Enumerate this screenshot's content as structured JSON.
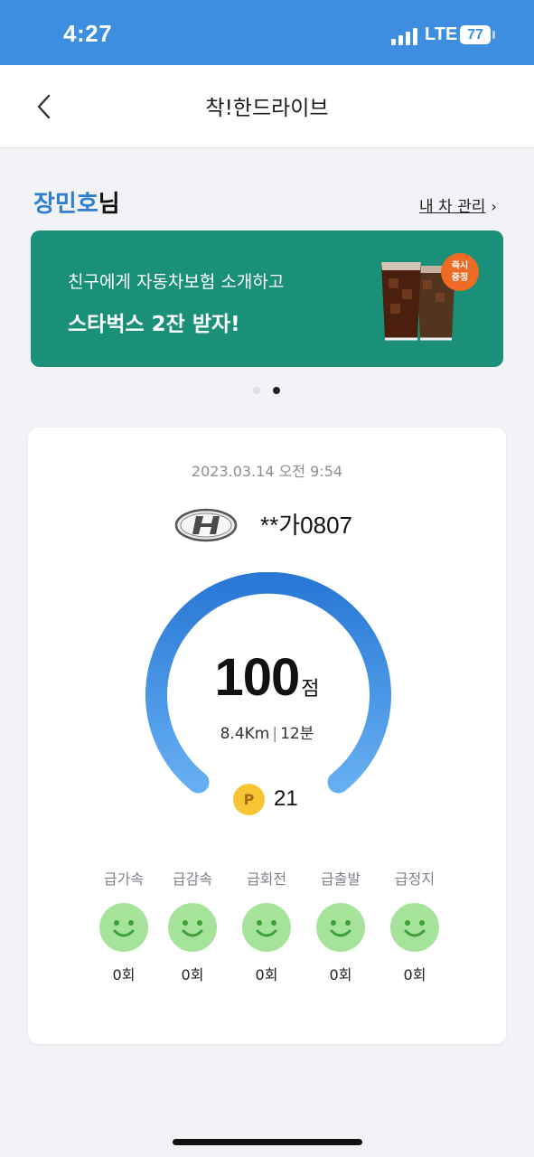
{
  "status_bar": {
    "time": "4:27",
    "network": "LTE",
    "battery": "77"
  },
  "nav": {
    "title": "착!한드라이브",
    "back_icon": "chevron-left-icon"
  },
  "greeting": {
    "name": "장민호",
    "suffix": "님"
  },
  "car_manage": {
    "label": "내 차 관리",
    "chevron": "›"
  },
  "banner": {
    "line1": "친구에게 자동차보험 소개하고",
    "line2": "스타벅스 2잔 받자!",
    "badge_line1": "즉시",
    "badge_line2": "증정",
    "image": "iced-coffee-cups",
    "background": "#1b9079",
    "badge_color": "#ef6b23"
  },
  "pagination": {
    "total": 2,
    "active": 2
  },
  "drive": {
    "datetime": "2023.03.14 오전 9:54",
    "car_logo": "hyundai-logo-icon",
    "plate": "**가0807",
    "score": "100",
    "score_unit": "점",
    "distance": "8.4Km",
    "duration": "12분",
    "points_icon": "P",
    "points": "21",
    "gauge_color": "#2f80db",
    "metrics": [
      {
        "label": "급가속",
        "count": "0회",
        "icon": "smiley-face-icon"
      },
      {
        "label": "급감속",
        "count": "0회",
        "icon": "smiley-face-icon"
      },
      {
        "label": "급회전",
        "count": "0회",
        "icon": "smiley-face-icon"
      },
      {
        "label": "급출발",
        "count": "0회",
        "icon": "smiley-face-icon"
      },
      {
        "label": "급정지",
        "count": "0회",
        "icon": "smiley-face-icon"
      }
    ]
  }
}
